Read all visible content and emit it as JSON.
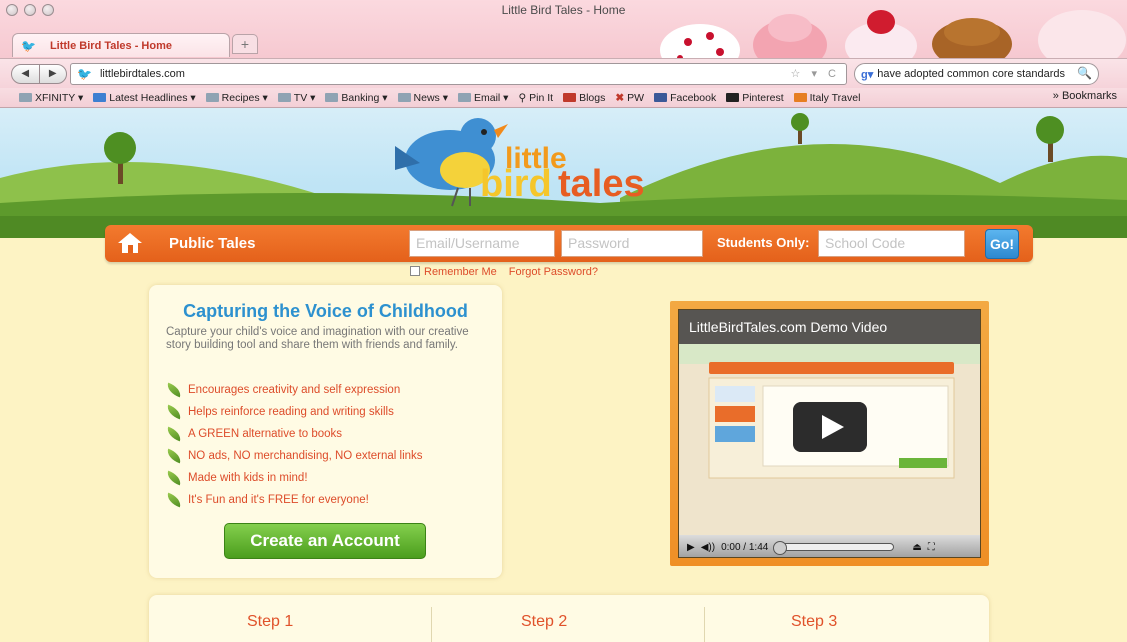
{
  "browser": {
    "window_title": "Little Bird Tales - Home",
    "tab_title": "Little Bird Tales - Home",
    "new_tab": "+",
    "url": "littlebirdtales.com",
    "search_query": "have adopted common core standards",
    "bookmarks": [
      {
        "label": "XFINITY ▾",
        "icon": "folder-icon"
      },
      {
        "label": "Latest Headlines ▾",
        "icon": "rss-icon"
      },
      {
        "label": "Recipes ▾",
        "icon": "folder-icon"
      },
      {
        "label": "TV ▾",
        "icon": "folder-icon"
      },
      {
        "label": "Banking ▾",
        "icon": "folder-icon"
      },
      {
        "label": "News ▾",
        "icon": "folder-icon"
      },
      {
        "label": "Email ▾",
        "icon": "folder-icon"
      },
      {
        "label": "Pin It",
        "icon": "pin-icon"
      },
      {
        "label": "Blogs",
        "icon": "folder-icon"
      },
      {
        "label": "PW",
        "icon": "pw-icon"
      },
      {
        "label": "Facebook",
        "icon": "facebook-icon"
      },
      {
        "label": "Pinterest",
        "icon": "pinterest-icon"
      },
      {
        "label": "Italy Travel",
        "icon": "bt-icon"
      }
    ],
    "bookmarks_overflow": "» Bookmarks"
  },
  "site": {
    "logo_little": "little",
    "logo_bird": "bird",
    "logo_tales": "tales",
    "nav": {
      "public_tales": "Public Tales",
      "email_placeholder": "Email/Username",
      "password_placeholder": "Password",
      "students_only": "Students Only:",
      "school_code_placeholder": "School Code",
      "go": "Go!"
    },
    "remember_me": "Remember Me",
    "forgot_password": "Forgot Password?",
    "intro_card": {
      "title": "Capturing the Voice of Childhood",
      "text": "Capture your child's voice and imagination with our creative story building tool and share them with friends and family.",
      "features": [
        "Encourages creativity and self expression",
        "Helps reinforce reading and writing skills",
        "A GREEN alternative to books",
        "NO ads, NO merchandising, NO external links",
        "Made with kids in mind!",
        "It's Fun and it's FREE for everyone!"
      ],
      "cta": "Create an Account"
    },
    "video": {
      "title": "LittleBirdTales.com Demo Video",
      "time": "0:00 / 1:44"
    },
    "steps": [
      "Step 1",
      "Step 2",
      "Step 3"
    ]
  }
}
